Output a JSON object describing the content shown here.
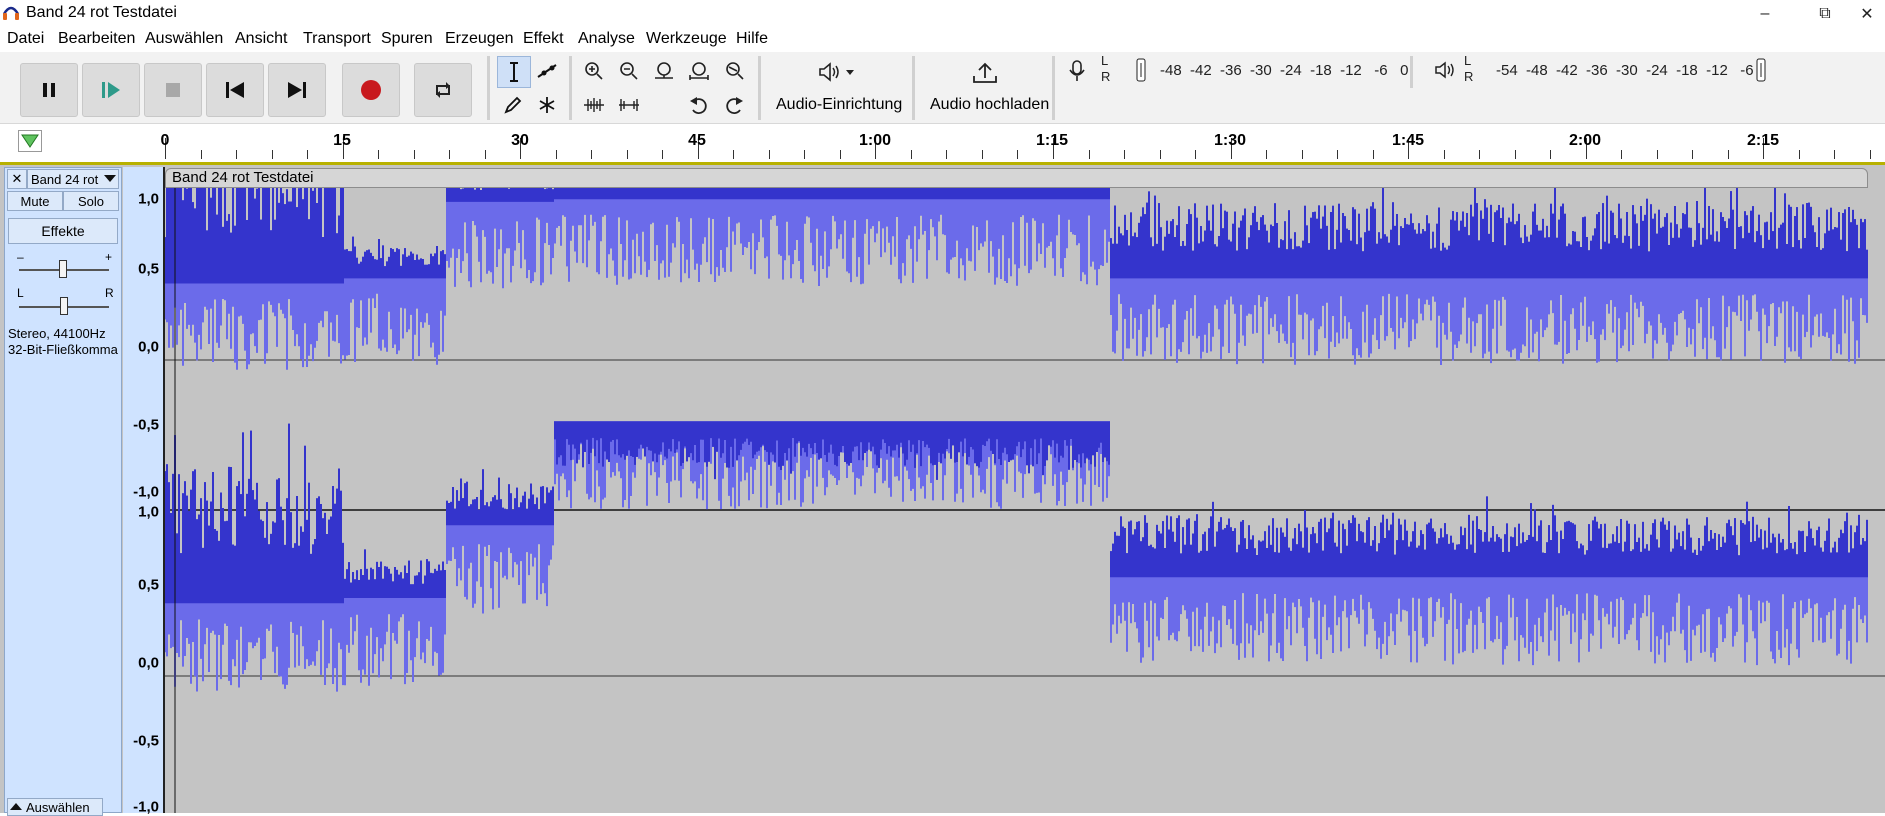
{
  "window": {
    "title": "Band 24 rot Testdatei",
    "minimize_label": "–",
    "restore_label": "⧉",
    "close_label": "✕"
  },
  "menu": [
    "Datei",
    "Bearbeiten",
    "Auswählen",
    "Ansicht",
    "Transport",
    "Spuren",
    "Erzeugen",
    "Effekt",
    "Analyse",
    "Werkzeuge",
    "Hilfe"
  ],
  "toolbar": {
    "audio_setup_label": "Audio-Einrichtung",
    "audio_share_label": "Audio hochladen",
    "rec_meter": {
      "l": "L",
      "r": "R",
      "scale": "-48  -42  -36  -30  -24  -18  -12   -6   0"
    },
    "play_meter": {
      "l": "L",
      "r": "R",
      "scale": "-54  -48  -42  -36  -30  -24  -18  -12   -6"
    }
  },
  "ruler": {
    "labels": [
      "0",
      "15",
      "30",
      "45",
      "1:00",
      "1:15",
      "1:30",
      "1:45",
      "2:00",
      "2:15"
    ]
  },
  "track": {
    "name": "Band 24 rot",
    "mute_label": "Mute",
    "solo_label": "Solo",
    "effects_label": "Effekte",
    "gain_minus": "–",
    "gain_plus": "+",
    "pan_l": "L",
    "pan_r": "R",
    "format_line1": "Stereo, 44100Hz",
    "format_line2": "32-Bit-Fließkomma",
    "select_label": "Auswählen",
    "clip_name": "Band 24 rot Testdatei"
  },
  "vertical_ruler": {
    "top_channel": [
      "1,0",
      "0,5",
      "0,0",
      "-0,5",
      "-1,0"
    ],
    "bottom_channel": [
      "1,0",
      "0,5",
      "0,0",
      "-0,5",
      "-1,0"
    ]
  },
  "colors": {
    "waveform_peak": "#3434cc",
    "waveform_rms": "#6b6bea",
    "track_bg": "#c4c4c4",
    "panel_bg": "#cfe3ff",
    "record_red": "#c8191e",
    "play_green": "#2e9a8a"
  },
  "waveform_envelope": {
    "description_units": "amplitude 0..1 per segment",
    "segments": [
      {
        "t0": 0,
        "t1": 0.105,
        "level_top": 0.82,
        "level_base": 0.3,
        "bottom_level": 0.28
      },
      {
        "t0": 0.105,
        "t1": 0.165,
        "level_top": 0.45,
        "level_base": 0.32,
        "bottom_level": 0.3
      },
      {
        "t0": 0.165,
        "t1": 0.228,
        "level_top": 0.75,
        "level_base": 0.62,
        "bottom_level": 0.58
      },
      {
        "t0": 0.228,
        "t1": 0.555,
        "level_top": 0.8,
        "level_base": 0.63,
        "bottom_level": 0.98
      },
      {
        "t0": 0.555,
        "t1": 1.0,
        "level_top": 0.62,
        "level_base": 0.32,
        "bottom_level": 0.38
      }
    ]
  }
}
